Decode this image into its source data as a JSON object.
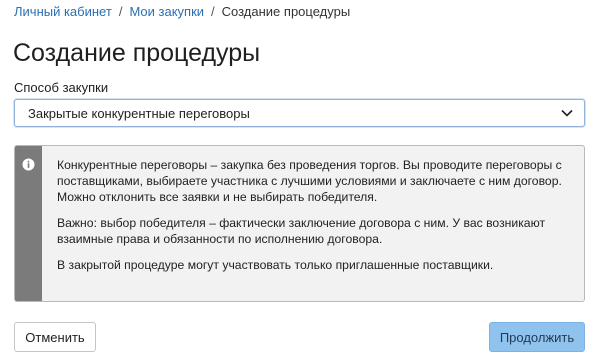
{
  "breadcrumb": {
    "items": [
      {
        "label": "Личный кабинет"
      },
      {
        "label": "Мои закупки"
      }
    ],
    "separator": "/",
    "current": "Создание процедуры"
  },
  "page": {
    "title": "Создание процедуры"
  },
  "procurement_method": {
    "label": "Способ закупки",
    "selected_value": "Закрытые конкурентные переговоры",
    "icon": "chevron-down-icon"
  },
  "info": {
    "icon": "info-icon",
    "paragraphs": [
      "Конкурентные переговоры – закупка без проведения торгов. Вы проводите переговоры с поставщиками, выбираете участника с лучшими условиями и заключаете с ним договор. Можно отклонить все заявки и не выбирать победителя.",
      "Важно: выбор победителя – фактически заключение договора с ним. У вас возникают взаимные права и обязанности по исполнению договора.",
      "В закрытой процедуре могут участвовать только приглашенные поставщики."
    ]
  },
  "actions": {
    "cancel_label": "Отменить",
    "continue_label": "Продолжить"
  },
  "colors": {
    "link": "#2a6fb5",
    "primary_button": "#8fc3ee",
    "info_stripe": "#7b7b7b",
    "info_background": "#f2f2f2"
  }
}
